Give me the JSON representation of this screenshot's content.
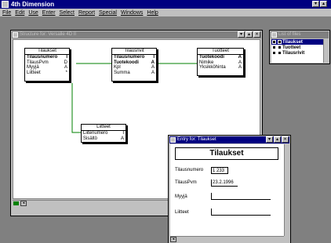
{
  "app": {
    "title": "4th Dimension"
  },
  "menu": {
    "items": [
      "File",
      "Edit",
      "Use",
      "Enter",
      "Select",
      "Report",
      "Special",
      "Windows",
      "Help"
    ]
  },
  "structure_window": {
    "title": "Structure for: Versalle 4D II",
    "tables": [
      {
        "name": "Tilaukset",
        "fields": [
          {
            "name": "Tilausnumero",
            "type": "I",
            "bold": true
          },
          {
            "name": "TilausPvm",
            "type": "D",
            "bold": false
          },
          {
            "name": "Myyjä",
            "type": "A",
            "bold": false
          },
          {
            "name": "Liitteet",
            "type": "*",
            "bold": false
          }
        ]
      },
      {
        "name": "Tilausrivit",
        "fields": [
          {
            "name": "Tilausnumero",
            "type": "I",
            "bold": true
          },
          {
            "name": "Tuotekoodi",
            "type": "A",
            "bold": true
          },
          {
            "name": "Kpl",
            "type": "A",
            "bold": false
          },
          {
            "name": "Summa",
            "type": "A",
            "bold": false
          }
        ]
      },
      {
        "name": "Tuotteet",
        "fields": [
          {
            "name": "Tuotekoodi",
            "type": "A",
            "bold": true
          },
          {
            "name": "Nimike",
            "type": "A",
            "bold": false
          },
          {
            "name": "Yksikköhinta",
            "type": "A",
            "bold": false
          }
        ]
      },
      {
        "name": "Liitteet",
        "fields": [
          {
            "name": "Liitenumero",
            "type": "I",
            "bold": false
          },
          {
            "name": "Sisältö",
            "type": "A",
            "bold": false
          }
        ]
      }
    ]
  },
  "file_list": {
    "title": "List of files",
    "files": [
      {
        "name": "Tilaukset",
        "selected": true
      },
      {
        "name": "Tuotteet",
        "selected": false
      },
      {
        "name": "Tilausrivit",
        "selected": false
      }
    ]
  },
  "entry_window": {
    "title": "Entry for: Tilaukset",
    "form_title": "Tilaukset",
    "fields": [
      {
        "label": "Tilausnumero",
        "value": "1 233"
      },
      {
        "label": "TilausPvm",
        "value": "23.2.1996"
      },
      {
        "label": "Myyjä",
        "value": ""
      },
      {
        "label": "Liitteet",
        "value": ""
      }
    ]
  },
  "colors": {
    "title_active": "#000080",
    "workspace": "#808080",
    "link_line": "#008000"
  },
  "icons": [
    "app-icon",
    "minimize-icon",
    "maximize-icon",
    "close-icon",
    "scroll-arrow-icon",
    "file-table-icon"
  ]
}
